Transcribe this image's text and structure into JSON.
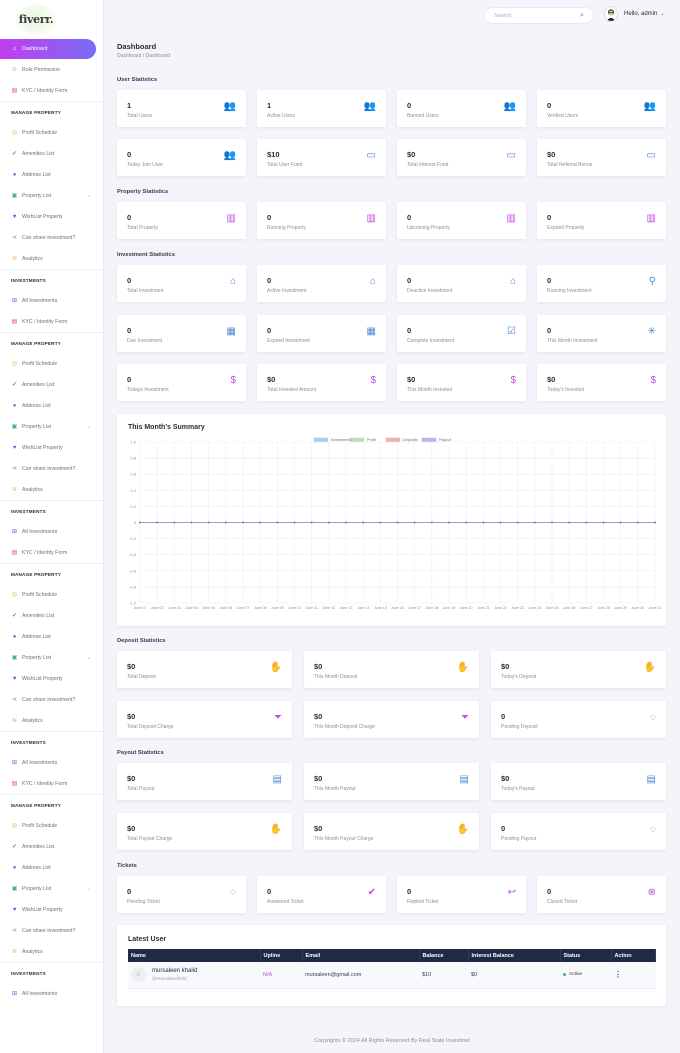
{
  "brand": {
    "logo_text": "fiverr."
  },
  "sidebar": {
    "top_items": [
      {
        "label": "Dashboard",
        "icon": "home-icon"
      },
      {
        "label": "Role Permission",
        "icon": "users-icon"
      },
      {
        "label": "KYC / Identity Form",
        "icon": "file-icon"
      }
    ],
    "groups": [
      {
        "title": "MANAGE PROPERTY",
        "items": [
          "Profit Schedule",
          "Amenities List",
          "Address List",
          "Property List",
          "WishList Property",
          "Can share investment?",
          "Analytics"
        ]
      },
      {
        "title": "INVESTMENTS",
        "items": [
          "All Investments",
          "KYC / Identity Form"
        ]
      },
      {
        "title": "MANAGE PROPERTY",
        "items": [
          "Profit Schedule",
          "Amenities List",
          "Address List",
          "Property List",
          "WishList Property",
          "Can share investment?",
          "Analytics"
        ]
      },
      {
        "title": "INVESTMENTS",
        "items": [
          "All Investments",
          "KYC / Identity Form"
        ]
      },
      {
        "title": "MANAGE PROPERTY",
        "items": [
          "Profit Schedule",
          "Amenities List",
          "Address List",
          "Property List",
          "WishList Property",
          "Can share investment?",
          "Analytics"
        ]
      },
      {
        "title": "INVESTMENTS",
        "items": [
          "All Investments",
          "KYC / Identity Form"
        ]
      },
      {
        "title": "MANAGE PROPERTY",
        "items": [
          "Profit Schedule",
          "Amenities List",
          "Address List",
          "Property List",
          "WishList Property",
          "Can share investment?",
          "Analytics"
        ]
      },
      {
        "title": "INVESTMENTS",
        "items": [
          "All Investments"
        ]
      }
    ]
  },
  "topbar": {
    "search_placeholder": "Search",
    "greeting": "Hello, admin"
  },
  "page": {
    "title": "Dashboard",
    "breadcrumb": "Dashboard  /   Dashboard"
  },
  "sections": {
    "user": "User Statistics",
    "property": "Property Statistics",
    "investment": "Investment Statistics",
    "deposit": "Deposit Statistics",
    "payout": "Payout Statistics",
    "tickets": "Tickets"
  },
  "cards": {
    "user": [
      {
        "value": "1",
        "label": "Total Users",
        "icon": "users-icon"
      },
      {
        "value": "1",
        "label": "Active Users",
        "icon": "users-icon"
      },
      {
        "value": "0",
        "label": "Banned Users",
        "icon": "users-icon"
      },
      {
        "value": "0",
        "label": "Verified Users",
        "icon": "users-icon"
      },
      {
        "value": "0",
        "label": "Today Join User",
        "icon": "users-icon"
      },
      {
        "value": "$10",
        "label": "Total User Fund",
        "icon": "money-icon"
      },
      {
        "value": "$0",
        "label": "Total Interest Fund",
        "icon": "money-icon"
      },
      {
        "value": "$0",
        "label": "Total Referral Bonus",
        "icon": "money-icon"
      }
    ],
    "property": [
      {
        "value": "0",
        "label": "Total Property",
        "icon": "building-icon"
      },
      {
        "value": "0",
        "label": "Running Property",
        "icon": "building-icon"
      },
      {
        "value": "0",
        "label": "Upcoming Property",
        "icon": "building-icon"
      },
      {
        "value": "0",
        "label": "Expired Property",
        "icon": "building-icon"
      }
    ],
    "investment": [
      {
        "value": "0",
        "label": "Total Investment",
        "icon": "store-icon"
      },
      {
        "value": "0",
        "label": "Active Investment",
        "icon": "store-icon"
      },
      {
        "value": "0",
        "label": "Deactive Investment",
        "icon": "store-icon"
      },
      {
        "value": "0",
        "label": "Running Investment",
        "icon": "runner-icon"
      },
      {
        "value": "0",
        "label": "Due Investment",
        "icon": "calendar-icon"
      },
      {
        "value": "0",
        "label": "Expired Investment",
        "icon": "calendar-icon"
      },
      {
        "value": "0",
        "label": "Complete Investment",
        "icon": "calendar-check-icon"
      },
      {
        "value": "0",
        "label": "This Month Investment",
        "icon": "asterisk-icon"
      },
      {
        "value": "0",
        "label": "Todays Investment",
        "icon": "dollar-icon"
      },
      {
        "value": "$0",
        "label": "Total Invested Amount",
        "icon": "dollar-icon"
      },
      {
        "value": "$0",
        "label": "This Month Invested",
        "icon": "dollar-icon"
      },
      {
        "value": "$0",
        "label": "Today's Invested",
        "icon": "dollar-icon"
      }
    ],
    "deposit": [
      {
        "value": "$0",
        "label": "Total Deposit",
        "icon": "hand-coin-icon"
      },
      {
        "value": "$0",
        "label": "This Month Deposit",
        "icon": "hand-coin-icon"
      },
      {
        "value": "$0",
        "label": "Today's Deposit",
        "icon": "hand-coin-icon"
      },
      {
        "value": "$0",
        "label": "Total Deposit Charge",
        "icon": "filter-dollar-icon"
      },
      {
        "value": "$0",
        "label": "This Month Deposit Charge",
        "icon": "filter-dollar-icon"
      },
      {
        "value": "0",
        "label": "Pending Deposit",
        "icon": "spinner-icon"
      }
    ],
    "payout": [
      {
        "value": "$0",
        "label": "Total Payout",
        "icon": "invoice-dollar-icon"
      },
      {
        "value": "$0",
        "label": "This Month Payout",
        "icon": "invoice-dollar-icon"
      },
      {
        "value": "$0",
        "label": "Today's Payout",
        "icon": "invoice-dollar-icon"
      },
      {
        "value": "$0",
        "label": "Total Payout Charge",
        "icon": "hand-coin-icon"
      },
      {
        "value": "$0",
        "label": "This Month Payout Charge",
        "icon": "hand-coin-icon"
      },
      {
        "value": "0",
        "label": "Pending Payout",
        "icon": "spinner-icon"
      }
    ],
    "tickets": [
      {
        "value": "0",
        "label": "Pending Ticket",
        "icon": "spinner-icon"
      },
      {
        "value": "0",
        "label": "Answered Ticket",
        "icon": "check-icon"
      },
      {
        "value": "0",
        "label": "Replied Ticket",
        "icon": "reply-icon"
      },
      {
        "value": "0",
        "label": "Closed Ticket",
        "icon": "close-circle-icon"
      }
    ]
  },
  "chart": {
    "title": "This Month's Summary"
  },
  "chart_data": {
    "type": "line",
    "x": [
      "June 01",
      "June 02",
      "June 03",
      "June 04",
      "June 05",
      "June 06",
      "June 07",
      "June 08",
      "June 09",
      "June 10",
      "June 11",
      "June 12",
      "June 13",
      "June 14",
      "June 15",
      "June 16",
      "June 17",
      "June 18",
      "June 19",
      "June 20",
      "June 21",
      "June 22",
      "June 23",
      "June 24",
      "June 25",
      "June 26",
      "June 27",
      "June 28",
      "June 29",
      "June 30",
      "June 31"
    ],
    "series": [
      {
        "name": "Investments",
        "color": "#8fb7e0",
        "values": [
          0,
          0,
          0,
          0,
          0,
          0,
          0,
          0,
          0,
          0,
          0,
          0,
          0,
          0,
          0,
          0,
          0,
          0,
          0,
          0,
          0,
          0,
          0,
          0,
          0,
          0,
          0,
          0,
          0,
          0,
          0
        ]
      },
      {
        "name": "Profit",
        "color": "#9ad49a",
        "values": [
          0,
          0,
          0,
          0,
          0,
          0,
          0,
          0,
          0,
          0,
          0,
          0,
          0,
          0,
          0,
          0,
          0,
          0,
          0,
          0,
          0,
          0,
          0,
          0,
          0,
          0,
          0,
          0,
          0,
          0,
          0
        ]
      },
      {
        "name": "Deposits",
        "color": "#e88f8f",
        "values": [
          0,
          0,
          0,
          0,
          0,
          0,
          0,
          0,
          0,
          0,
          0,
          0,
          0,
          0,
          0,
          0,
          0,
          0,
          0,
          0,
          0,
          0,
          0,
          0,
          0,
          0,
          0,
          0,
          0,
          0,
          0
        ]
      },
      {
        "name": "Payout",
        "color": "#9d93dc",
        "values": [
          0,
          0,
          0,
          0,
          0,
          0,
          0,
          0,
          0,
          0,
          0,
          0,
          0,
          0,
          0,
          0,
          0,
          0,
          0,
          0,
          0,
          0,
          0,
          0,
          0,
          0,
          0,
          0,
          0,
          0,
          0
        ]
      }
    ],
    "yticks": [
      "1.0",
      "0.8",
      "0.6",
      "0.4",
      "0.2",
      "0",
      "-0.2",
      "-0.4",
      "-0.6",
      "-0.8",
      "-1.0"
    ],
    "ylim": [
      -1,
      1
    ],
    "grid": true,
    "legend": "top-center"
  },
  "latest_user": {
    "title": "Latest User",
    "columns": [
      "Name",
      "Upline",
      "Email",
      "Balance",
      "Interest Balance",
      "Status",
      "Action"
    ],
    "rows": [
      {
        "name": "mursaleen khalid",
        "handle": "@mursaleenkhld",
        "upline": "N/A",
        "email": "mursaleen@gmail.com",
        "balance": "$10",
        "interest": "$0",
        "status": "Active",
        "action": "⋮"
      }
    ]
  },
  "footer": "Copyrights © 2024 All Rights Reserved By Real State Investmet"
}
